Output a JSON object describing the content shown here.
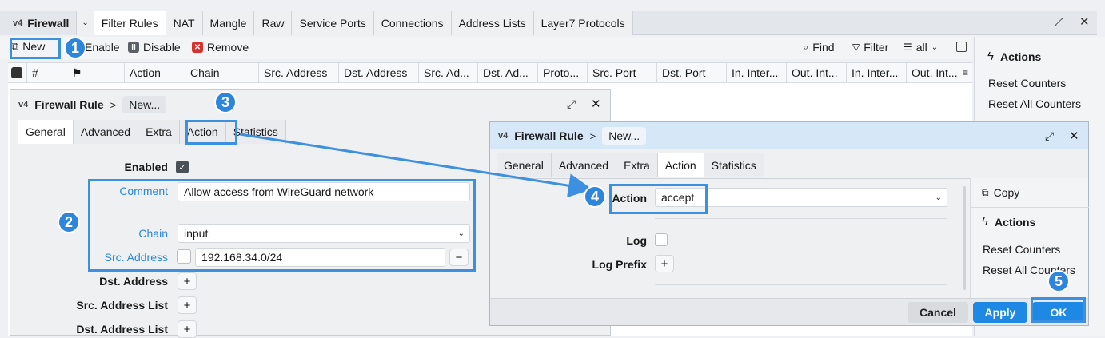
{
  "window": {
    "title": "Firewall",
    "tabs": [
      "Filter Rules",
      "NAT",
      "Mangle",
      "Raw",
      "Service Ports",
      "Connections",
      "Address Lists",
      "Layer7 Protocols"
    ]
  },
  "toolbar": {
    "new_label": "New",
    "enable_label": "Enable",
    "disable_label": "Disable",
    "remove_label": "Remove",
    "find_label": "Find",
    "filter_label": "Filter",
    "filter_value": "all"
  },
  "table": {
    "columns": [
      "#",
      "Action",
      "Chain",
      "Src. Address",
      "Dst. Address",
      "Src. Ad...",
      "Dst. Ad...",
      "Proto...",
      "Src. Port",
      "Dst. Port",
      "In. Inter...",
      "Out. Int...",
      "In. Inter...",
      "Out. Int..."
    ]
  },
  "side_panel": {
    "heading": "Actions",
    "items": [
      "Reset Counters",
      "Reset All Counters"
    ]
  },
  "dialog1": {
    "title": "Firewall Rule",
    "crumb": "New...",
    "tabs": [
      "General",
      "Advanced",
      "Extra",
      "Action",
      "Statistics"
    ],
    "enabled_label": "Enabled",
    "comment_label": "Comment",
    "comment_value": "Allow access from WireGuard network",
    "chain_label": "Chain",
    "chain_value": "input",
    "src_address_label": "Src. Address",
    "src_address_value": "192.168.34.0/24",
    "dst_address_label": "Dst. Address",
    "src_address_list_label": "Src. Address List",
    "dst_address_list_label": "Dst. Address List"
  },
  "dialog2": {
    "title": "Firewall Rule",
    "crumb": "New...",
    "tabs": [
      "General",
      "Advanced",
      "Extra",
      "Action",
      "Statistics"
    ],
    "action_label": "Action",
    "action_value": "accept",
    "log_label": "Log",
    "log_prefix_label": "Log Prefix",
    "copy_label": "Copy",
    "actions_heading": "Actions",
    "side_items": [
      "Reset Counters",
      "Reset All Counters"
    ],
    "cancel_label": "Cancel",
    "apply_label": "Apply",
    "ok_label": "OK"
  },
  "steps": [
    "1",
    "2",
    "3",
    "4",
    "5"
  ],
  "colors": {
    "highlight": "#3d8fe0",
    "badge": "#2d86db",
    "button_primary": "#1e88e5",
    "link_label": "#2a86d6"
  }
}
